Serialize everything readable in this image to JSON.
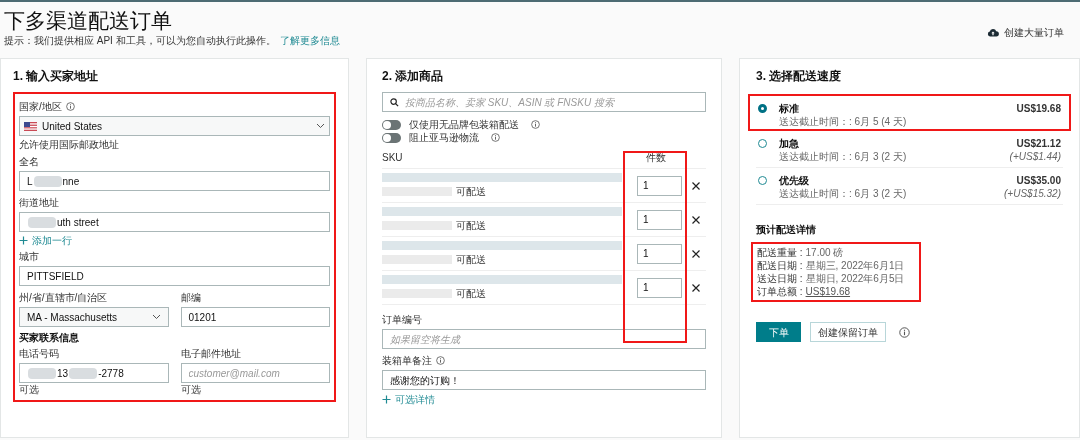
{
  "page": {
    "title": "下多渠道配送订单",
    "hint": "提示：我们提供相应 API 和工具，可以为您自动执行此操作。",
    "hint_link": "了解更多信息",
    "bulk_button": "创建大量订单"
  },
  "address": {
    "heading": "1. 输入买家地址",
    "highlighted": true,
    "country": {
      "label": "国家/地区",
      "value": "United States",
      "hint": "允许使用国际邮政地址"
    },
    "full_name": {
      "label": "全名",
      "segments": [
        {
          "kind": "text",
          "text": "L"
        },
        {
          "kind": "redacted"
        },
        {
          "kind": "text",
          "text": "nne"
        }
      ]
    },
    "street": {
      "label": "街道地址",
      "segments": [
        {
          "kind": "redacted"
        },
        {
          "kind": "text",
          "text": "uth street"
        }
      ]
    },
    "add_line": "添加一行",
    "city": {
      "label": "城市",
      "value": "PITTSFIELD"
    },
    "state": {
      "label": "州/省/直辖市/自治区",
      "value": "MA - Massachusetts"
    },
    "zip": {
      "label": "邮编",
      "value": "01201"
    },
    "contact_heading": "买家联系信息",
    "phone": {
      "label": "电话号码",
      "segments": [
        {
          "kind": "redacted"
        },
        {
          "kind": "text",
          "text": "13"
        },
        {
          "kind": "redacted"
        },
        {
          "kind": "text",
          "text": "-2778"
        }
      ],
      "note": "可选"
    },
    "email": {
      "label": "电子邮件地址",
      "placeholder": "customer@mail.com",
      "note": "可选"
    }
  },
  "products": {
    "heading": "2. 添加商品",
    "search_placeholder": "按商品名称、卖家 SKU、ASIN 或 FNSKU 搜索",
    "toggles": [
      {
        "label": "仅使用无品牌包装箱配送",
        "on": false
      },
      {
        "label": "阻止亚马逊物流",
        "on": false
      }
    ],
    "columns": [
      "SKU",
      "件数"
    ],
    "quantity_highlighted": true,
    "rows": [
      {
        "status": "可配送",
        "quantity": "1"
      },
      {
        "status": "可配送",
        "quantity": "1"
      },
      {
        "status": "可配送",
        "quantity": "1"
      },
      {
        "status": "可配送",
        "quantity": "1"
      }
    ],
    "order_id": {
      "label": "订单编号",
      "placeholder": "如果留空将生成"
    },
    "packing_note": {
      "label": "装箱单备注",
      "value": "感谢您的订购！"
    },
    "optional_details": "可选详情"
  },
  "shipping": {
    "heading": "3. 选择配送速度",
    "options": [
      {
        "name": "标准",
        "deadline": "送达截止时间：: 6月 5 (4 天)",
        "price": "US$19.68",
        "selected": true,
        "highlighted": true
      },
      {
        "name": "加急",
        "deadline": "送达截止时间：: 6月 3 (2 天)",
        "price": "US$21.12",
        "extra": "(+US$1.44)",
        "selected": false,
        "highlighted": false
      },
      {
        "name": "优先级",
        "deadline": "送达截止时间：: 6月 3 (2 天)",
        "price": "US$35.00",
        "extra": "(+US$15.32)",
        "selected": false,
        "highlighted": false
      }
    ],
    "details_heading": "预计配送详情",
    "details_highlighted": true,
    "details": [
      {
        "kind": "text",
        "label": "配送重量 :",
        "value": "17.00 磅"
      },
      {
        "kind": "text",
        "label": "配送日期 :",
        "value": "星期三, 2022年6月1日"
      },
      {
        "kind": "text",
        "label": "送达日期 :",
        "value": "星期日, 2022年6月5日"
      },
      {
        "kind": "link",
        "label": "订单总额 :",
        "value": "US$19.68"
      }
    ],
    "buttons": [
      {
        "kind": "primary",
        "label": "下单"
      },
      {
        "kind": "secondary",
        "label": "创建保留订单"
      }
    ]
  }
}
